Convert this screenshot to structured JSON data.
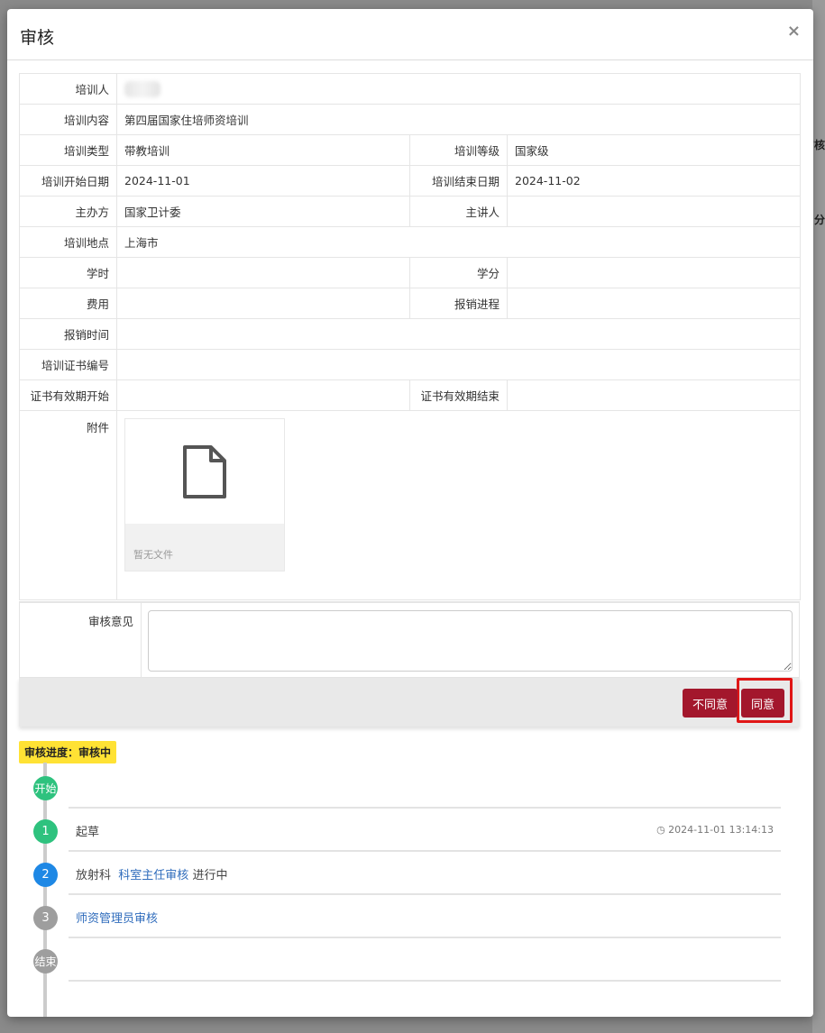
{
  "background": {
    "fragments": [
      "审核",
      "分"
    ]
  },
  "modal": {
    "title": "审核",
    "close": "×"
  },
  "info": {
    "trainee_label": "培训人",
    "content_label": "培训内容",
    "content_value": "第四届国家住培师资培训",
    "type_label": "培训类型",
    "type_value": "带教培训",
    "level_label": "培训等级",
    "level_value": "国家级",
    "start_label": "培训开始日期",
    "start_value": "2024-11-01",
    "end_label": "培训结束日期",
    "end_value": "2024-11-02",
    "organizer_label": "主办方",
    "organizer_value": "国家卫计委",
    "speaker_label": "主讲人",
    "speaker_value": "",
    "location_label": "培训地点",
    "location_value": "上海市",
    "hours_label": "学时",
    "hours_value": "",
    "credit_label": "学分",
    "credit_value": "",
    "fee_label": "费用",
    "fee_value": "",
    "reimburse_progress_label": "报销进程",
    "reimburse_progress_value": "",
    "reimburse_time_label": "报销时间",
    "reimburse_time_value": "",
    "cert_no_label": "培训证书编号",
    "cert_no_value": "",
    "cert_start_label": "证书有效期开始",
    "cert_start_value": "",
    "cert_end_label": "证书有效期结束",
    "cert_end_value": "",
    "attachment_label": "附件",
    "attachment_empty": "暂无文件"
  },
  "opinion": {
    "label": "审核意见",
    "value": ""
  },
  "actions": {
    "reject": "不同意",
    "agree": "同意"
  },
  "progress": {
    "badge": "审核进度：审核中",
    "colors": {
      "done": "#2ec27e",
      "active": "#1e88e5",
      "pending": "#9e9e9e"
    },
    "start": "开始",
    "end": "结束",
    "steps": [
      {
        "num": "1",
        "text": "起草",
        "time": "2024-11-01 13:14:13"
      },
      {
        "num": "2",
        "dept": "放射科",
        "link": "科室主任审核",
        "status": "进行中"
      },
      {
        "num": "3",
        "link": "师资管理员审核"
      }
    ]
  }
}
